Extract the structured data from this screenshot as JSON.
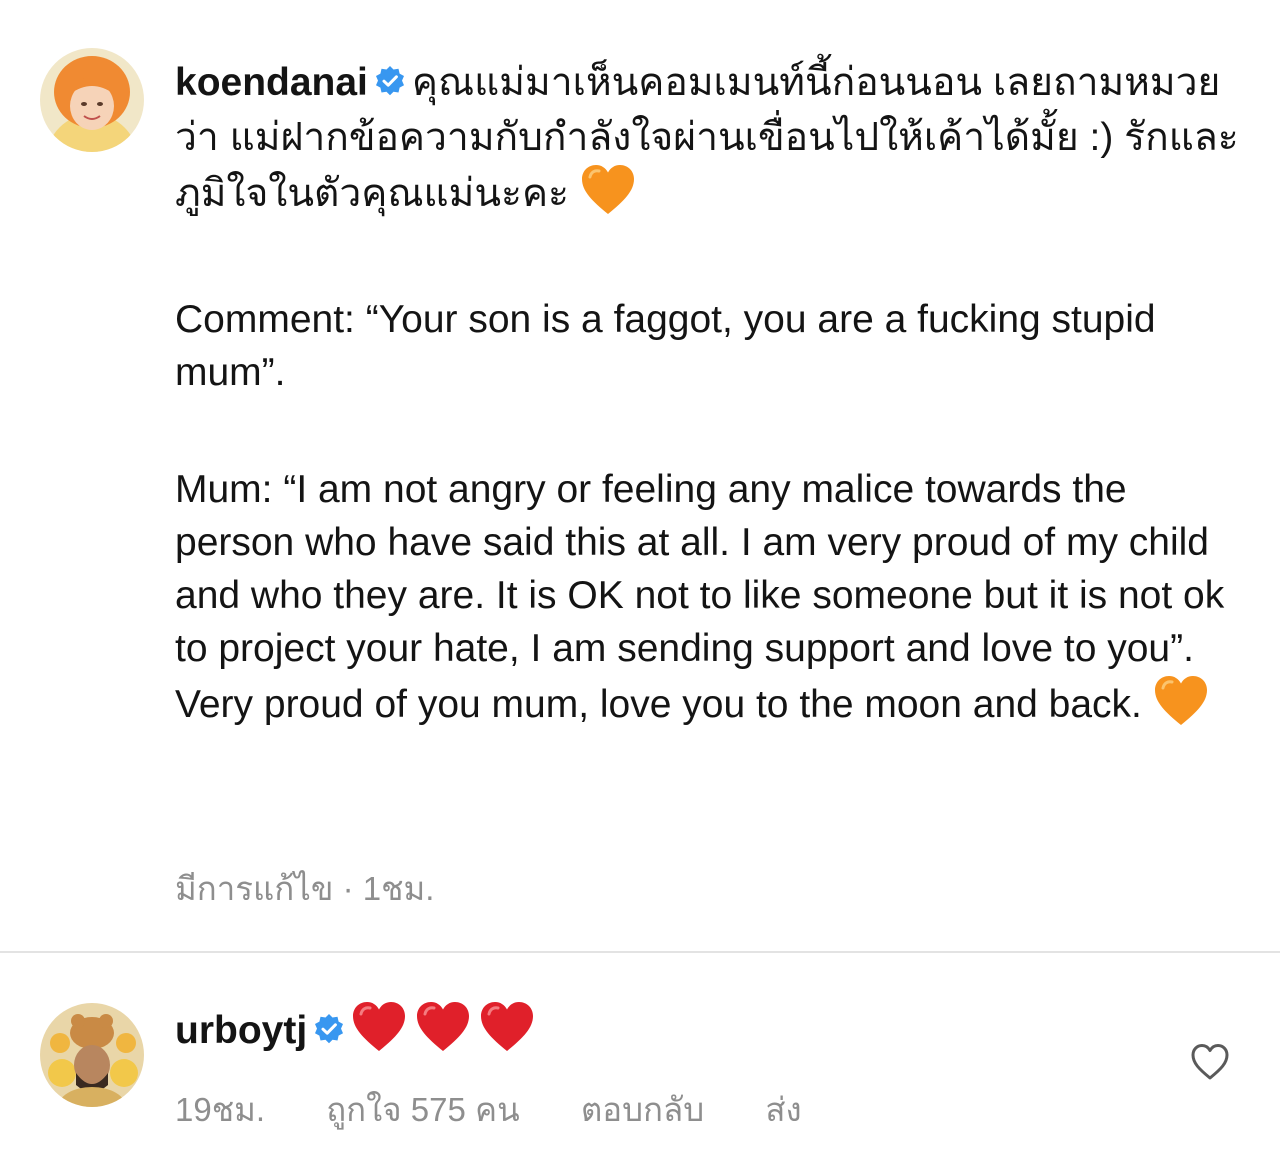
{
  "comment1": {
    "username": "koendanai",
    "verified": true,
    "text_thai": "คุณแม่มาเห็นคอมเมนท์นี้ก่อนนอน เลยถามหมวยว่า แม่ฝากข้อความกับกำลังใจผ่านเขื่อนไปให้เค้าได้มั้ย :) รักและภูมิใจในตัวคุณแม่นะคะ",
    "text_comment": "Comment: “Your son is a faggot, you are a fucking stupid mum”.",
    "text_mum": "Mum: “I am not angry or feeling any malice towards the person who have said this at all. I am very proud of my child and who they are. It is OK not to like someone but it is not ok to project your hate, I am sending support and love to you”. Very proud of you mum, love you to the moon and back.",
    "emoji": "orange-heart",
    "edited_label": "มีการแก้ไข",
    "separator": "·",
    "time": "1ชม.",
    "avatar_icon": "avatar-orange-hair"
  },
  "comment2": {
    "username": "urboytj",
    "verified": true,
    "emoji_count": 3,
    "emoji": "red-heart",
    "time": "19ชม.",
    "likes_label": "ถูกใจ 575 คน",
    "reply_label": "ตอบกลับ",
    "send_label": "ส่ง",
    "avatar_icon": "avatar-bear-headdress"
  },
  "colors": {
    "text": "#141414",
    "meta": "#8e8e8e",
    "verified": "#3897f0",
    "orange_heart": "#f7931e",
    "red_heart": "#e0202a",
    "divider": "#e3e3e3"
  }
}
